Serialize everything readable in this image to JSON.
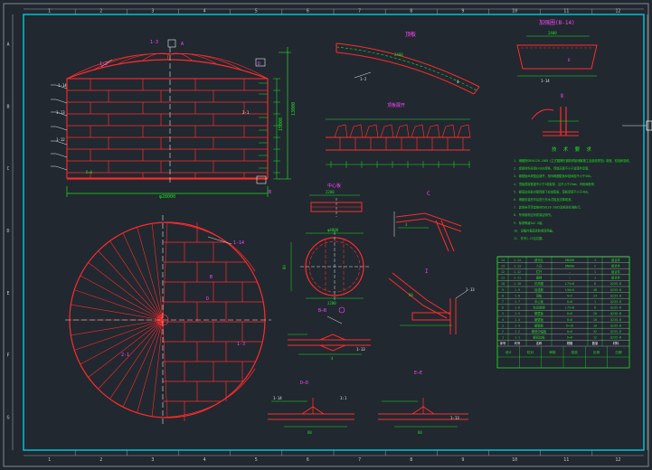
{
  "colors": {
    "background": "#212830",
    "frame": "#00c8e0",
    "border": "#c8c8c8",
    "geometry": "#ff2b2b",
    "dimension": "#22dd22",
    "label": "#ff44ff",
    "leader": "#ffffff",
    "axis": "#e8e8e8"
  },
  "grid_top": [
    "1",
    "2",
    "3",
    "4",
    "5",
    "6",
    "7",
    "8",
    "9",
    "10",
    "11",
    "12"
  ],
  "grid_side": [
    "A",
    "B",
    "C",
    "D",
    "E",
    "F",
    "G"
  ],
  "titles": {
    "top_detail": "顶板",
    "top_plate": "顶板",
    "sec_ii": "顶板展开",
    "center_plate": "中心板",
    "sec_c": "C",
    "sec_i": "I",
    "node": "Ⅱ",
    "bb": "B—B",
    "dd": "D—D",
    "ee": "E—E",
    "right_detail": "加强圈(B-14)"
  },
  "part_labels": {
    "a": "1-2",
    "b": "1-3",
    "c": "1-14",
    "d": "1-13",
    "e": "1-12",
    "f": "2-1",
    "g": "D",
    "h": "B",
    "i": "A"
  },
  "dims": {
    "tank_width": "φ28000",
    "tank_height": "13000",
    "shell_sub": "15000",
    "top_w": "2400",
    "plate_w": "2200",
    "cp_dia": "φ4000",
    "sec_dim": "80"
  },
  "notes_title": "技 术 要 求",
  "notes": [
    "1. 储罐按GB50128-2005《立式圆筒形钢制焊接储罐施工及验收规范》制造、检验和验收。",
    "2. 焊接材料采用E4303焊条，焊缝高度不小于较薄件厚度。",
    "3. 罐壁板纵焊缝应错开，相邻两圈壁板纵缝间距不小于500。",
    "4. 顶板搭接宽度不小于5倍板厚，且不小于25mm，内侧间断焊。",
    "5. 罐底边缘板对接焊缝下应加垫板，垫板厚度不小于4mm。",
    "6. 储罐安装完毕后进行充水试验及沉降观测。",
    "7. 其他未尽事宜按GB50128-2005及相关标准执行。",
    "8. 所有钢材应有质量证明书。",
    "9. 除锈等级Sa2.5级。",
    "10. 设备外表面涂防锈漆两遍。",
    "11. 件号1-13见总图。"
  ],
  "table": {
    "headers": [
      "序号",
      "代号",
      "名称",
      "规格",
      "数量",
      "材料"
    ],
    "rows": [
      [
        "1",
        "1-1",
        "罐底边板",
        "δ=8",
        "12",
        "Q235-B"
      ],
      [
        "2",
        "1-2",
        "罐底中幅板",
        "δ=6",
        "32",
        "Q235-B"
      ],
      [
        "3",
        "1-3",
        "罐壁板",
        "δ=10",
        "10",
        "Q235-B"
      ],
      [
        "4",
        "1-4",
        "罐壁板",
        "δ=8",
        "10",
        "Q235-B"
      ],
      [
        "5",
        "1-5",
        "罐壁板",
        "δ=6",
        "20",
        "Q235-B"
      ],
      [
        "6",
        "1-6",
        "包边角钢",
        "L75×8",
        "8",
        "Q235-B"
      ],
      [
        "7",
        "1-7",
        "中心板",
        "δ=6",
        "1",
        "Q235-B"
      ],
      [
        "8",
        "1-8",
        "顶板",
        "δ=5",
        "24",
        "Q235-B"
      ],
      [
        "9",
        "1-9",
        "加强筋",
        "L50×5",
        "48",
        "Q235-B"
      ],
      [
        "10",
        "1-10",
        "抗风圈",
        "L75×8",
        "8",
        "Q235-B"
      ],
      [
        "11",
        "1-11",
        "盘梯",
        "—",
        "1",
        "组合件"
      ],
      [
        "12",
        "1-12",
        "栏杆",
        "—",
        "1",
        "组合件"
      ],
      [
        "13",
        "1-13",
        "人孔",
        "DN600",
        "2",
        "组合件"
      ],
      [
        "14",
        "1-14",
        "透光孔",
        "DN500",
        "1",
        "组合件"
      ]
    ],
    "footer": [
      "设计",
      "校对",
      "审核",
      "批准",
      "比例",
      "日期"
    ]
  },
  "weld_labels": {
    "l1": "δ=6",
    "l2": "4",
    "l3": "3",
    "l4": "1:1"
  }
}
